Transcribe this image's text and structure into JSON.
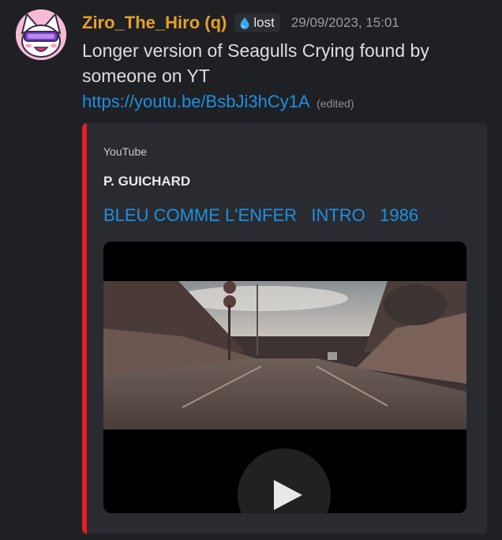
{
  "message": {
    "username": "Ziro_The_Hiro (q)",
    "role_tag": "lost",
    "timestamp": "29/09/2023, 15:01",
    "text_line1": "Longer version of Seagulls Crying found by",
    "text_line2": "someone on YT",
    "link": "https://youtu.be/BsbJi3hCy1A",
    "edited": "(edited)"
  },
  "embed": {
    "provider": "YouTube",
    "author": "P. GUICHARD",
    "title": "BLEU COMME L'ENFER   INTRO   1986",
    "accent_color": "#e41d23"
  },
  "colors": {
    "background": "#1f2024",
    "username": "#e6a02a",
    "link": "#1e8fe0",
    "embed_bg": "#2a2b30"
  },
  "icons": {
    "avatar": "pink-cat-avatar",
    "role": "water-drop-icon",
    "play": "play-icon"
  }
}
